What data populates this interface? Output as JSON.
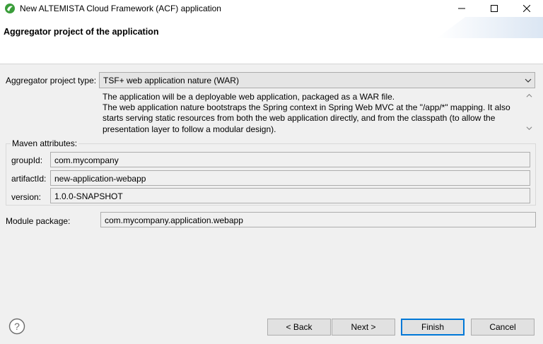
{
  "window": {
    "title": "New ALTEMISTA Cloud Framework (ACF) application",
    "icon": "app-icon",
    "controls": {
      "minimize_icon": "minimize-icon",
      "maximize_icon": "maximize-icon",
      "close_icon": "close-icon"
    }
  },
  "header": {
    "title": "Aggregator project of the application"
  },
  "aggregator": {
    "label": "Aggregator project type:",
    "selected": "TSF+ web application nature (WAR)",
    "description": [
      "The application will be a deployable web application, packaged as a WAR file.",
      "The web application nature bootstraps the Spring context in Spring Web MVC at the \"/app/*\" mapping. It also",
      "starts serving static resources from both the web application directly, and from the classpath (to allow the",
      "presentation layer to follow a modular design)."
    ]
  },
  "maven": {
    "legend": "Maven attributes:",
    "group_id": {
      "label": "groupId:",
      "value": "com.mycompany"
    },
    "artifact_id": {
      "label": "artifactId:",
      "value": "new-application-webapp"
    },
    "version": {
      "label": "version:",
      "value": "1.0.0-SNAPSHOT"
    }
  },
  "module": {
    "label": "Module package:",
    "value": "com.mycompany.application.webapp"
  },
  "buttons": {
    "help_icon": "help-icon",
    "back": "< Back",
    "next": "Next >",
    "finish": "Finish",
    "cancel": "Cancel"
  },
  "colors": {
    "background": "#f0f0f0",
    "header_background": "#ffffff",
    "primary_button_border": "#0078d7",
    "app_icon_green": "#3a9d3a"
  }
}
